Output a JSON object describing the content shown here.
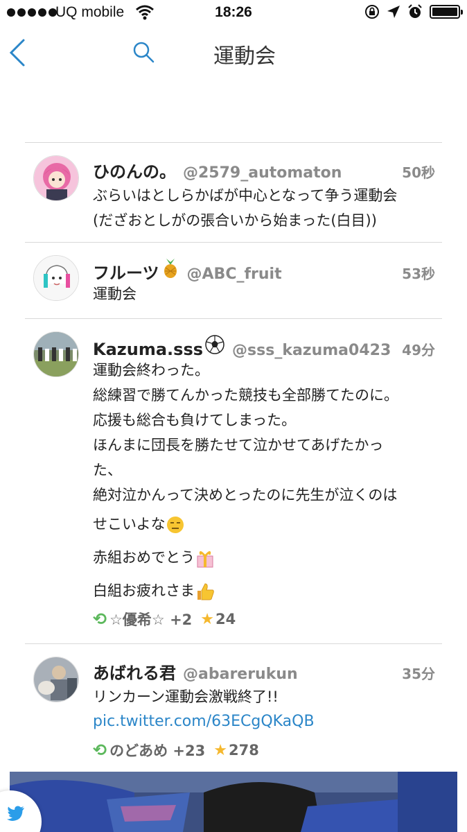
{
  "status_bar": {
    "carrier": "UQ mobile",
    "time": "18:26"
  },
  "nav": {
    "title": "運動会",
    "back_icon": "chevron-left-icon",
    "search_icon": "search-icon"
  },
  "colors": {
    "accent": "#2b86c8",
    "retweet": "#5cb85c",
    "favorite": "#f5b82e",
    "meta": "#8a8a8a"
  },
  "tweets": [
    {
      "name": "ひのんの。",
      "handle": "@2579_automaton",
      "time": "50秒",
      "lines": [
        "ぶらいはとしらかばが中心となって争う運動会",
        "(だざおとしがの張合いから始まった(白目))"
      ]
    },
    {
      "name": "フルーツ",
      "name_emoji": "pineapple",
      "handle": "@ABC_fruit",
      "time": "53秒",
      "lines": [
        "運動会"
      ]
    },
    {
      "name": "Kazuma.sss",
      "name_emoji": "soccer-ball",
      "handle": "@sss_kazuma0423",
      "time": "49分",
      "lines": [
        "運動会終わった。",
        "総練習で勝てんかった競技も全部勝てたのに。",
        " 応援も総合も負けてしまった。",
        "ほんまに団長を勝たせて泣かせてあげたかっ",
        "た、",
        "絶対泣かんって決めとったのに先生が泣くのは",
        "せこいよな",
        "赤組おめでとう",
        "白組お疲れさま"
      ],
      "retweeted_by": "☆優希☆ +2",
      "favorites": "24"
    },
    {
      "name": "あばれる君",
      "handle": "@abarerukun",
      "time": "35分",
      "lines": [
        "リンカーン運動会激戦終了!!"
      ],
      "link": "pic.twitter.com/63ECgQKaQB",
      "retweeted_by": "のどあめ +23",
      "favorites": "278"
    }
  ]
}
